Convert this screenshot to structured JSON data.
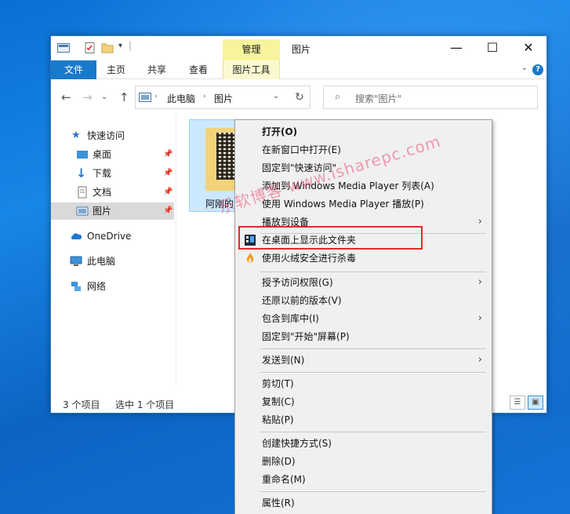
{
  "window": {
    "title": "图片",
    "contextual_tab": "管理"
  },
  "ribbon": {
    "tabs": [
      "文件",
      "主页",
      "共享",
      "查看",
      "图片工具"
    ]
  },
  "address": {
    "segments": [
      "此电脑",
      "图片"
    ],
    "search_placeholder": "搜索\"图片\""
  },
  "navpane": {
    "items": [
      {
        "label": "快速访问",
        "icon": "star-icon"
      },
      {
        "label": "桌面",
        "icon": "desktop-icon",
        "pinned": true
      },
      {
        "label": "下载",
        "icon": "download-icon",
        "pinned": true
      },
      {
        "label": "文档",
        "icon": "document-icon",
        "pinned": true
      },
      {
        "label": "图片",
        "icon": "pictures-icon",
        "pinned": true,
        "selected": true
      },
      {
        "label": "OneDrive",
        "icon": "cloud-icon"
      },
      {
        "label": "此电脑",
        "icon": "computer-icon"
      },
      {
        "label": "网络",
        "icon": "network-icon"
      }
    ]
  },
  "content": {
    "file_name": "阿刚的"
  },
  "status": {
    "item_count": "3 个项目",
    "selection": "选中 1 个项目"
  },
  "context_menu": {
    "items": [
      {
        "label": "打开(O)",
        "bold": true
      },
      {
        "label": "在新窗口中打开(E)"
      },
      {
        "label": "固定到\"快速访问\""
      },
      {
        "label": "添加到 Windows Media Player 列表(A)"
      },
      {
        "label": "使用 Windows Media Player 播放(P)"
      },
      {
        "label": "播放到设备",
        "submenu": true
      },
      {
        "label": "在桌面上显示此文件夹",
        "icon": "desktop-folder-icon"
      },
      {
        "label": "使用火绒安全进行杀毒",
        "icon": "huorong-icon"
      },
      {
        "label": "授予访问权限(G)",
        "submenu": true
      },
      {
        "label": "还原以前的版本(V)"
      },
      {
        "label": "包含到库中(I)",
        "submenu": true
      },
      {
        "label": "固定到\"开始\"屏幕(P)"
      },
      {
        "label": "发送到(N)",
        "submenu": true
      },
      {
        "label": "剪切(T)"
      },
      {
        "label": "复制(C)"
      },
      {
        "label": "粘贴(P)"
      },
      {
        "label": "创建快捷方式(S)"
      },
      {
        "label": "删除(D)"
      },
      {
        "label": "重命名(M)"
      },
      {
        "label": "属性(R)"
      }
    ]
  },
  "watermark": "乐软博客 www.isharepc.com",
  "colors": {
    "accent": "#1979ca",
    "manage_tab": "#f7f49e",
    "highlight_border": "#e02b2b",
    "selection": "#cce8ff"
  }
}
